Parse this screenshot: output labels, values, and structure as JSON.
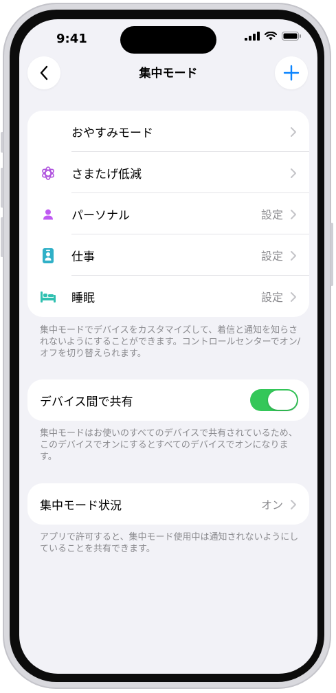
{
  "status_bar": {
    "time": "9:41"
  },
  "nav": {
    "title": "集中モード"
  },
  "focus_modes": [
    {
      "label": "おやすみモード",
      "value": "",
      "icon": "moon-icon",
      "color": "#5e5ce6"
    },
    {
      "label": "さまたげ低減",
      "value": "",
      "icon": "flower-icon",
      "color": "#af52de"
    },
    {
      "label": "パーソナル",
      "value": "設定",
      "icon": "person-icon",
      "color": "#bf5af2"
    },
    {
      "label": "仕事",
      "value": "設定",
      "icon": "badge-icon",
      "color": "#30b0c7"
    },
    {
      "label": "睡眠",
      "value": "設定",
      "icon": "bed-icon",
      "color": "#30c0b0"
    }
  ],
  "focus_modes_footnote": "集中モードでデバイスをカスタマイズして、着信と通知を知らされないようにすることができます。コントロールセンターでオン/オフを切り替えられます。",
  "share_devices": {
    "label": "デバイス間で共有",
    "enabled": true,
    "toggle_color": "#34c759",
    "footnote": "集中モードはお使いのすべてのデバイスで共有されているため、このデバイスでオンにするとすべてのデバイスでオンになります。"
  },
  "focus_status": {
    "label": "集中モード状況",
    "value": "オン",
    "footnote": "アプリで許可すると、集中モード使用中は通知されないようにしていることを共有できます。"
  },
  "colors": {
    "accent": "#0a84ff",
    "background": "#f2f2f7"
  }
}
